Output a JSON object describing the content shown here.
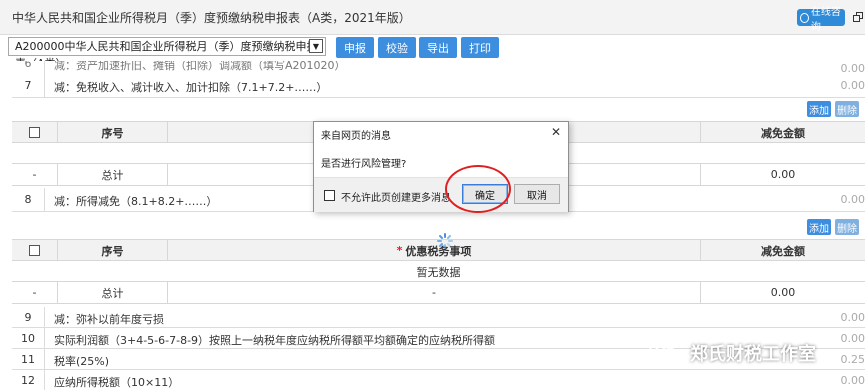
{
  "header": {
    "title": "中华人民共和国企业所得税月（季）度预缴纳税申报表（A类，2021年版）",
    "consult_label": "在线咨询"
  },
  "toolbar": {
    "form_select": "A200000中华人民共和国企业所得税月（季）度预缴纳税申报表（A类）",
    "buttons": [
      "申报",
      "校验",
      "导出",
      "打印"
    ]
  },
  "rows_top": [
    {
      "num": "6",
      "label": "减：资产加速折旧、摊销（扣除）调减额（填写A201020）",
      "value": "0.00"
    },
    {
      "num": "7",
      "label": "减：免税收入、减计收入、加计扣除（7.1+7.2+……）",
      "value": "0.00"
    }
  ],
  "subtable1": {
    "add_label": "添加",
    "delete_label": "删除",
    "col_seq": "序号",
    "col_amount": "减免金额",
    "total_dash": "-",
    "total_label": "总计",
    "total_value": "0.00"
  },
  "row8": {
    "num": "8",
    "label": "减：所得减免（8.1+8.2+……）",
    "value": "0.00"
  },
  "subtable2": {
    "add_label": "添加",
    "delete_label": "删除",
    "col_seq": "序号",
    "col_item_required": "*",
    "col_item": "优惠税务事项",
    "col_amount": "减免金额",
    "empty_text": "暂无数据",
    "total_dash": "-",
    "total_label": "总计",
    "total_mid": "-",
    "total_value": "0.00"
  },
  "rows_bottom": [
    {
      "num": "9",
      "label": "减：弥补以前年度亏损",
      "value": "0.00"
    },
    {
      "num": "10",
      "label": "实际利润额（3+4-5-6-7-8-9）按照上一纳税年度应纳税所得额平均额确定的应纳税所得额",
      "value": "0.00"
    },
    {
      "num": "11",
      "label": "税率(25%)",
      "value": "0.25"
    },
    {
      "num": "12",
      "label": "应纳所得税额（10×11）",
      "value": "0.00"
    }
  ],
  "dialog": {
    "title": "来自网页的消息",
    "message": "是否进行风险管理?",
    "checkbox_label": "不允许此页创建更多消息",
    "ok_label": "确定",
    "cancel_label": "取消"
  },
  "watermark": "郑氏财税工作室",
  "colors": {
    "accent": "#3e8ee0",
    "highlight_circle": "#e02020"
  }
}
